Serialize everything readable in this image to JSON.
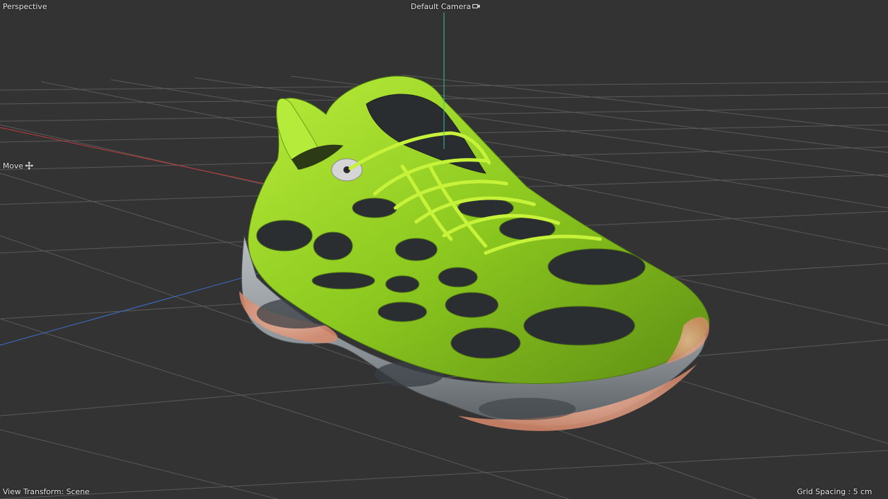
{
  "viewport": {
    "view_name": "Perspective",
    "camera": "Default Camera",
    "camera_icon": "camera-link-icon",
    "active_tool": "Move",
    "tool_icon": "move-icon",
    "view_transform": "View Transform: Scene",
    "grid_spacing": "Grid Spacing : 5 cm"
  },
  "colors": {
    "background": "#333333",
    "grid": "#5a5a5a",
    "axis_x": "#c43b3b",
    "axis_y": "#3fbf88",
    "axis_z": "#3b6fd0",
    "model_green": "#9bd32a",
    "model_sole": "#9ea4a8",
    "model_accent": "#e9a58a"
  },
  "scene": {
    "model": "3D sneaker model with green upper, laces and gray sole"
  }
}
